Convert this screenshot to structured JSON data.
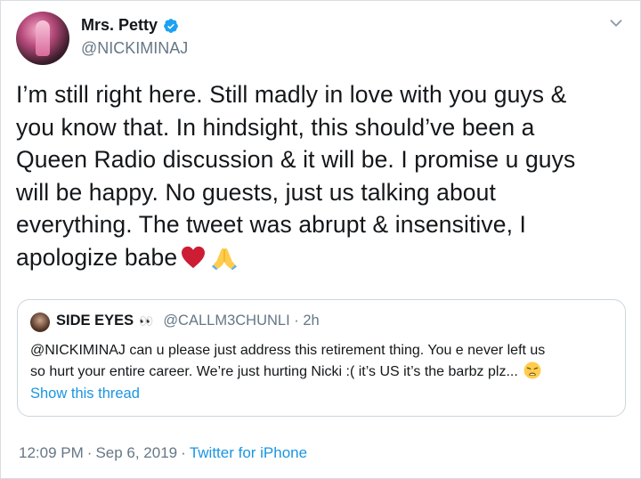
{
  "user": {
    "display_name": "Mrs. Petty",
    "handle": "@NICKIMINAJ"
  },
  "tweet": {
    "lines": [
      "I’m still right here. Still madly in love with you guys &",
      "you know that. In hindsight, this should’ve been a",
      "Queen Radio discussion & it will be. I promise u guys",
      "will be happy. No guests, just us talking about",
      "everything. The tweet was abrupt & insensitive, I",
      "apologize babe"
    ],
    "emojis": [
      "red-heart",
      "folded-hands"
    ]
  },
  "quoted_tweet": {
    "display_name": "SIDE EYES",
    "eyes_emoji": "👀",
    "handle_time": "@CALLM3CHUNLI · 2h",
    "lines": [
      "@NICKIMINAJ can u please just address this retirement thing. You e never left us",
      "so hurt your entire career. We’re just hurting Nicki :( it’s US it’s the barbz plz..."
    ],
    "show_thread": "Show this thread"
  },
  "meta": {
    "time": "12:09 PM",
    "date": "Sep 6, 2019",
    "separator": "·",
    "source": "Twitter for iPhone"
  },
  "colors": {
    "link": "#1b95e0",
    "secondary_text": "#657786",
    "border": "#ccd6dd"
  }
}
